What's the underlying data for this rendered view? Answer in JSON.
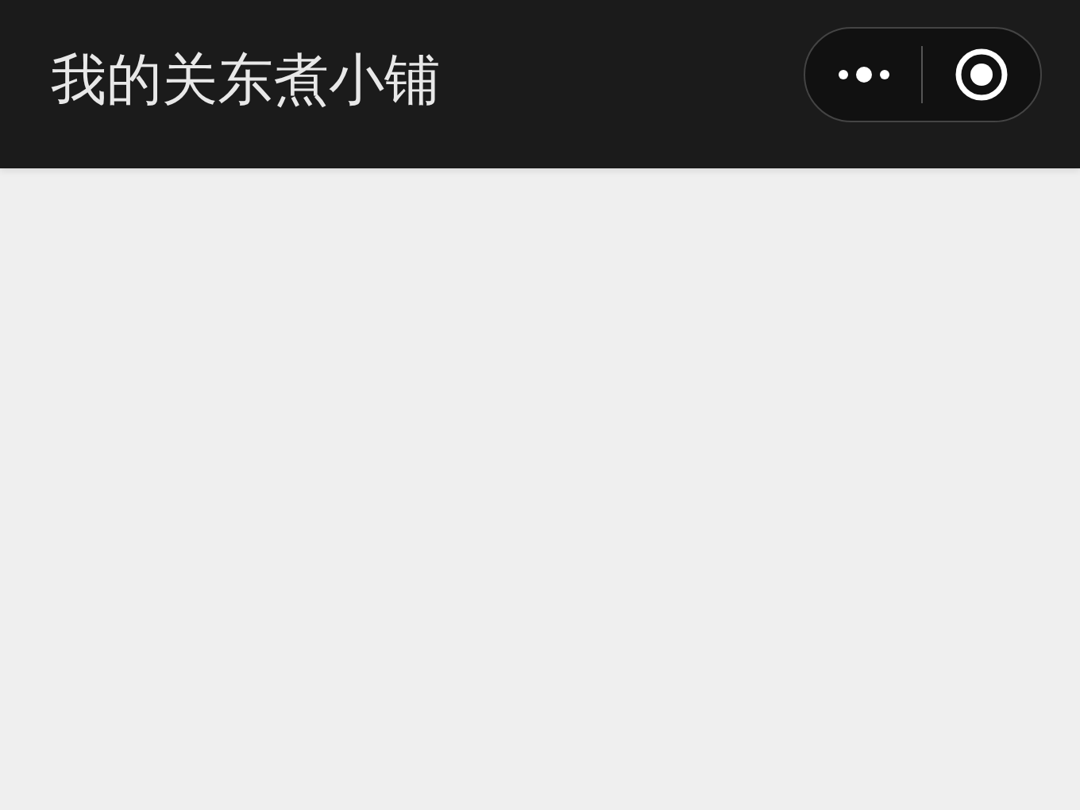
{
  "nav_bar": {
    "title": "我的关东煮小铺"
  }
}
